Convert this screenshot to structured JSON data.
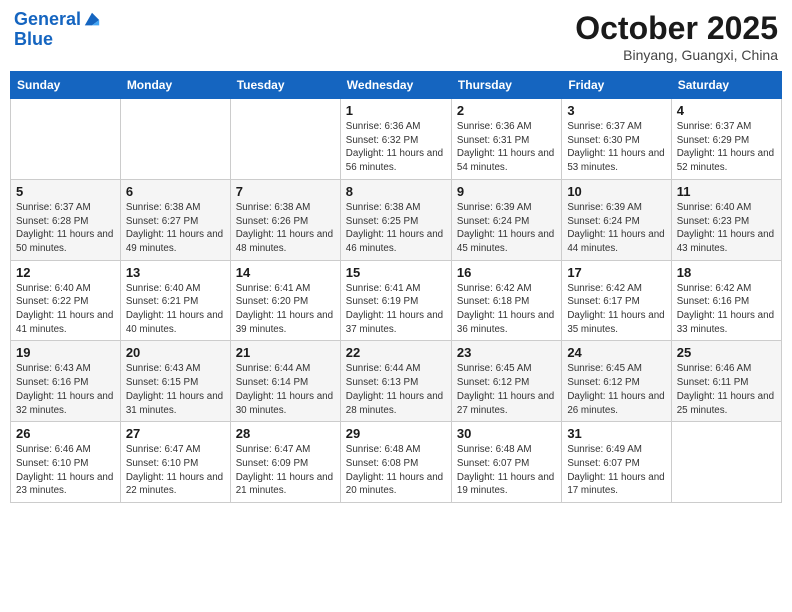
{
  "logo": {
    "line1": "General",
    "line2": "Blue"
  },
  "title": "October 2025",
  "location": "Binyang, Guangxi, China",
  "weekdays": [
    "Sunday",
    "Monday",
    "Tuesday",
    "Wednesday",
    "Thursday",
    "Friday",
    "Saturday"
  ],
  "weeks": [
    [
      {
        "day": "",
        "info": ""
      },
      {
        "day": "",
        "info": ""
      },
      {
        "day": "",
        "info": ""
      },
      {
        "day": "1",
        "info": "Sunrise: 6:36 AM\nSunset: 6:32 PM\nDaylight: 11 hours and 56 minutes."
      },
      {
        "day": "2",
        "info": "Sunrise: 6:36 AM\nSunset: 6:31 PM\nDaylight: 11 hours and 54 minutes."
      },
      {
        "day": "3",
        "info": "Sunrise: 6:37 AM\nSunset: 6:30 PM\nDaylight: 11 hours and 53 minutes."
      },
      {
        "day": "4",
        "info": "Sunrise: 6:37 AM\nSunset: 6:29 PM\nDaylight: 11 hours and 52 minutes."
      }
    ],
    [
      {
        "day": "5",
        "info": "Sunrise: 6:37 AM\nSunset: 6:28 PM\nDaylight: 11 hours and 50 minutes."
      },
      {
        "day": "6",
        "info": "Sunrise: 6:38 AM\nSunset: 6:27 PM\nDaylight: 11 hours and 49 minutes."
      },
      {
        "day": "7",
        "info": "Sunrise: 6:38 AM\nSunset: 6:26 PM\nDaylight: 11 hours and 48 minutes."
      },
      {
        "day": "8",
        "info": "Sunrise: 6:38 AM\nSunset: 6:25 PM\nDaylight: 11 hours and 46 minutes."
      },
      {
        "day": "9",
        "info": "Sunrise: 6:39 AM\nSunset: 6:24 PM\nDaylight: 11 hours and 45 minutes."
      },
      {
        "day": "10",
        "info": "Sunrise: 6:39 AM\nSunset: 6:24 PM\nDaylight: 11 hours and 44 minutes."
      },
      {
        "day": "11",
        "info": "Sunrise: 6:40 AM\nSunset: 6:23 PM\nDaylight: 11 hours and 43 minutes."
      }
    ],
    [
      {
        "day": "12",
        "info": "Sunrise: 6:40 AM\nSunset: 6:22 PM\nDaylight: 11 hours and 41 minutes."
      },
      {
        "day": "13",
        "info": "Sunrise: 6:40 AM\nSunset: 6:21 PM\nDaylight: 11 hours and 40 minutes."
      },
      {
        "day": "14",
        "info": "Sunrise: 6:41 AM\nSunset: 6:20 PM\nDaylight: 11 hours and 39 minutes."
      },
      {
        "day": "15",
        "info": "Sunrise: 6:41 AM\nSunset: 6:19 PM\nDaylight: 11 hours and 37 minutes."
      },
      {
        "day": "16",
        "info": "Sunrise: 6:42 AM\nSunset: 6:18 PM\nDaylight: 11 hours and 36 minutes."
      },
      {
        "day": "17",
        "info": "Sunrise: 6:42 AM\nSunset: 6:17 PM\nDaylight: 11 hours and 35 minutes."
      },
      {
        "day": "18",
        "info": "Sunrise: 6:42 AM\nSunset: 6:16 PM\nDaylight: 11 hours and 33 minutes."
      }
    ],
    [
      {
        "day": "19",
        "info": "Sunrise: 6:43 AM\nSunset: 6:16 PM\nDaylight: 11 hours and 32 minutes."
      },
      {
        "day": "20",
        "info": "Sunrise: 6:43 AM\nSunset: 6:15 PM\nDaylight: 11 hours and 31 minutes."
      },
      {
        "day": "21",
        "info": "Sunrise: 6:44 AM\nSunset: 6:14 PM\nDaylight: 11 hours and 30 minutes."
      },
      {
        "day": "22",
        "info": "Sunrise: 6:44 AM\nSunset: 6:13 PM\nDaylight: 11 hours and 28 minutes."
      },
      {
        "day": "23",
        "info": "Sunrise: 6:45 AM\nSunset: 6:12 PM\nDaylight: 11 hours and 27 minutes."
      },
      {
        "day": "24",
        "info": "Sunrise: 6:45 AM\nSunset: 6:12 PM\nDaylight: 11 hours and 26 minutes."
      },
      {
        "day": "25",
        "info": "Sunrise: 6:46 AM\nSunset: 6:11 PM\nDaylight: 11 hours and 25 minutes."
      }
    ],
    [
      {
        "day": "26",
        "info": "Sunrise: 6:46 AM\nSunset: 6:10 PM\nDaylight: 11 hours and 23 minutes."
      },
      {
        "day": "27",
        "info": "Sunrise: 6:47 AM\nSunset: 6:10 PM\nDaylight: 11 hours and 22 minutes."
      },
      {
        "day": "28",
        "info": "Sunrise: 6:47 AM\nSunset: 6:09 PM\nDaylight: 11 hours and 21 minutes."
      },
      {
        "day": "29",
        "info": "Sunrise: 6:48 AM\nSunset: 6:08 PM\nDaylight: 11 hours and 20 minutes."
      },
      {
        "day": "30",
        "info": "Sunrise: 6:48 AM\nSunset: 6:07 PM\nDaylight: 11 hours and 19 minutes."
      },
      {
        "day": "31",
        "info": "Sunrise: 6:49 AM\nSunset: 6:07 PM\nDaylight: 11 hours and 17 minutes."
      },
      {
        "day": "",
        "info": ""
      }
    ]
  ]
}
